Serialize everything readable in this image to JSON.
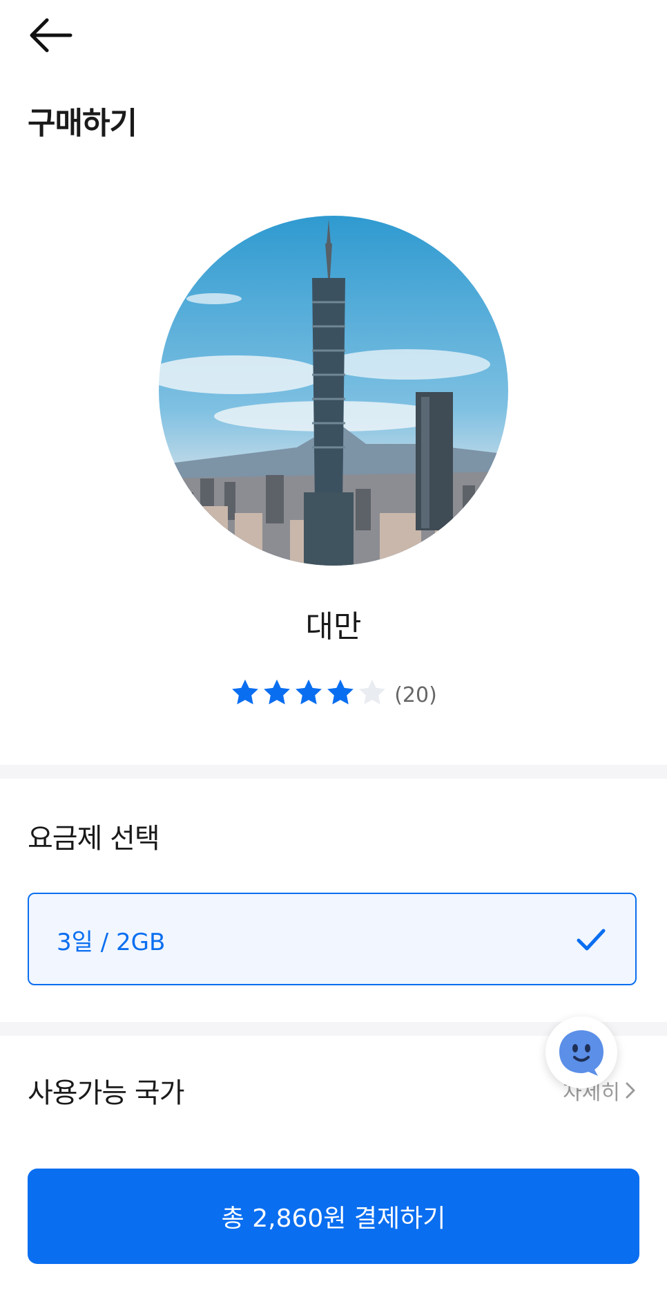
{
  "header": {
    "title": "구매하기",
    "back_icon": "arrow-left-icon"
  },
  "product": {
    "country": "대만",
    "rating": {
      "value": 4,
      "max": 5,
      "count_text": "(20)"
    }
  },
  "plan_section": {
    "title": "요금제 선택",
    "selected_plan": "3일 / 2GB"
  },
  "countries_section": {
    "title": "사용가능 국가",
    "detail_link": "자세히"
  },
  "chatbot": {
    "icon": "chatbot-icon"
  },
  "cta": {
    "label": "총 2,860원 결제하기"
  },
  "colors": {
    "accent": "#0a6ef0",
    "plan_bg": "#f1f6ff",
    "star_empty": "#e9ecf1",
    "divider": "#f5f5f7"
  }
}
